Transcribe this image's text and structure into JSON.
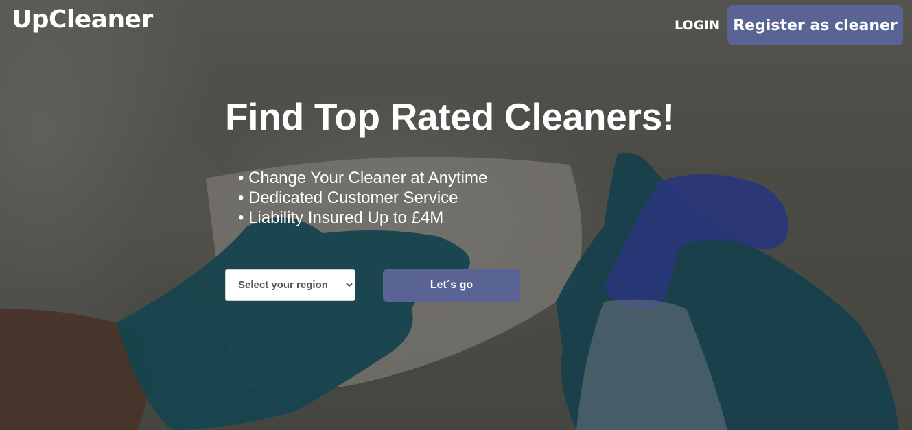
{
  "header": {
    "logo": "UpCleaner",
    "login_label": "LOGIN",
    "register_label": "Register as cleaner"
  },
  "hero": {
    "headline": "Find Top Rated Cleaners!",
    "features": [
      "• Change Your Cleaner at Anytime",
      "• Dedicated Customer Service",
      "• Liability Insured Up to £4M"
    ],
    "region_select": {
      "selected": "Select your region"
    },
    "go_label": "Let´s go"
  },
  "colors": {
    "accent": "#596494",
    "text": "#ffffff"
  }
}
